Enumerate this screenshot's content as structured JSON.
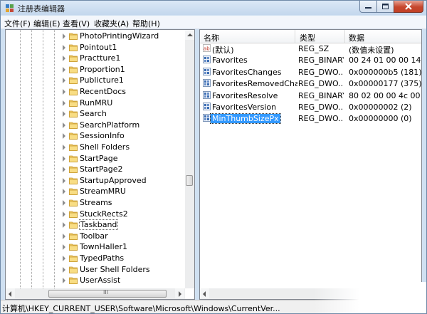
{
  "window": {
    "title": "注册表编辑器",
    "accent": "#3399ff"
  },
  "menu": [
    {
      "label": "文件(F)"
    },
    {
      "label": "编辑(E)"
    },
    {
      "label": "查看(V)"
    },
    {
      "label": "收藏夹(A)"
    },
    {
      "label": "帮助(H)"
    }
  ],
  "tree": {
    "items": [
      {
        "label": "PhotoPrintingWizard",
        "icon": "folder-icon"
      },
      {
        "label": "Pointout1",
        "icon": "folder-icon"
      },
      {
        "label": "Practture1",
        "icon": "folder-icon"
      },
      {
        "label": "Proportion1",
        "icon": "folder-icon"
      },
      {
        "label": "Publicture1",
        "icon": "folder-icon"
      },
      {
        "label": "RecentDocs",
        "icon": "folder-icon"
      },
      {
        "label": "RunMRU",
        "icon": "folder-icon"
      },
      {
        "label": "Search",
        "icon": "folder-icon"
      },
      {
        "label": "SearchPlatform",
        "icon": "folder-icon"
      },
      {
        "label": "SessionInfo",
        "icon": "folder-icon"
      },
      {
        "label": "Shell Folders",
        "icon": "folder-icon"
      },
      {
        "label": "StartPage",
        "icon": "folder-icon"
      },
      {
        "label": "StartPage2",
        "icon": "folder-icon"
      },
      {
        "label": "StartupApproved",
        "icon": "folder-icon"
      },
      {
        "label": "StreamMRU",
        "icon": "folder-icon"
      },
      {
        "label": "Streams",
        "icon": "folder-icon"
      },
      {
        "label": "StuckRects2",
        "icon": "folder-icon"
      },
      {
        "label": "Taskband",
        "icon": "folder-icon",
        "selected": true
      },
      {
        "label": "Toolbar",
        "icon": "folder-icon"
      },
      {
        "label": "TownHaller1",
        "icon": "folder-icon"
      },
      {
        "label": "TypedPaths",
        "icon": "folder-icon"
      },
      {
        "label": "User Shell Folders",
        "icon": "folder-icon"
      },
      {
        "label": "UserAssist",
        "icon": "folder-icon"
      }
    ]
  },
  "values": {
    "columns": {
      "name": "名称",
      "type": "类型",
      "data": "数据"
    },
    "rows": [
      {
        "name": "(默认)",
        "type": "REG_SZ",
        "data": "(数值未设置)",
        "icon": "string-value-icon"
      },
      {
        "name": "Favorites",
        "type": "REG_BINARY",
        "data": "00 24 01 00 00 14 00 1",
        "icon": "binary-value-icon"
      },
      {
        "name": "FavoritesChanges",
        "type": "REG_DWO...",
        "data": "0x000000b5 (181)",
        "icon": "binary-value-icon"
      },
      {
        "name": "FavoritesRemovedChan...",
        "type": "REG_DWO...",
        "data": "0x00000177 (375)",
        "icon": "binary-value-icon"
      },
      {
        "name": "FavoritesResolve",
        "type": "REG_BINARY",
        "data": "80 02 00 00 4c 00 00 0",
        "icon": "binary-value-icon"
      },
      {
        "name": "FavoritesVersion",
        "type": "REG_DWO...",
        "data": "0x00000002 (2)",
        "icon": "binary-value-icon"
      },
      {
        "name": "MinThumbSizePx",
        "type": "REG_DWO...",
        "data": "0x00000000 (0)",
        "icon": "binary-value-icon",
        "selected": true
      }
    ]
  },
  "status": {
    "path": "计算机\\HKEY_CURRENT_USER\\Software\\Microsoft\\Windows\\CurrentVer..."
  },
  "scrollbar": {
    "grip": "III"
  }
}
